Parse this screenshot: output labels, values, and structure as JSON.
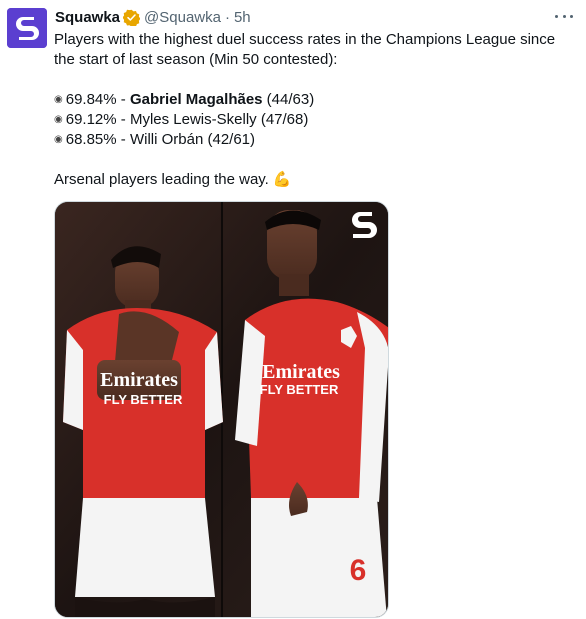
{
  "account": {
    "display_name": "Squawka",
    "handle": "@Squawka",
    "separator": "·",
    "time": "5h",
    "avatar_letter": "S",
    "brand_color": "#5b3fd0",
    "verified_color": "#e8a600"
  },
  "tweet": {
    "line1": "Players with the highest duel success rates in the Champions League since",
    "line2": "the start of last season (Min 50 contested):",
    "rows": [
      {
        "medal": "◉",
        "percent": "69.84% - ",
        "player": "Gabriel Magalhães",
        "record": " (44/63)",
        "bold": true
      },
      {
        "medal": "◉",
        "percent": "69.12% - ",
        "player": "Myles Lewis-Skelly",
        "record": " (47/68)",
        "bold": false
      },
      {
        "medal": "◉",
        "percent": "68.85% - ",
        "player": "Willi Orbán",
        "record": " (42/61)",
        "bold": false
      }
    ],
    "closing": "Arsenal players leading the way.",
    "closing_emoji": "💪"
  },
  "media": {
    "sponsor_line1": "Emirates",
    "sponsor_line2": "FLY BETTER",
    "shirt_number": "6",
    "kit_red": "#d8302a",
    "kit_white": "#f4f4f4"
  },
  "icons": {
    "more": "more-options-icon",
    "verified": "verified-badge-icon",
    "watermark": "squawka-logo-icon"
  }
}
